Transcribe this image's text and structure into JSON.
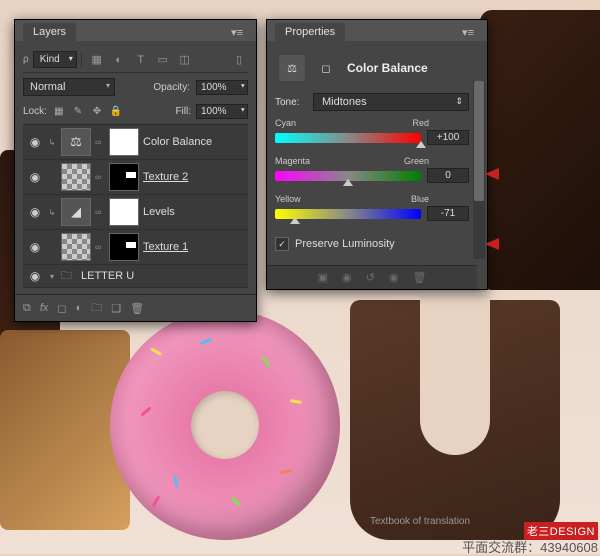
{
  "layers_panel": {
    "title": "Layers",
    "filter_kind": "Kind",
    "blend_mode": "Normal",
    "opacity_label": "Opacity:",
    "opacity_value": "100%",
    "lock_label": "Lock:",
    "fill_label": "Fill:",
    "fill_value": "100%",
    "layers": [
      {
        "name": "Color Balance",
        "type": "adjustment",
        "icon": "⚖︎"
      },
      {
        "name": "Texture 2",
        "type": "texture",
        "underlined": true
      },
      {
        "name": "Levels",
        "type": "adjustment",
        "icon": "◢"
      },
      {
        "name": "Texture 1",
        "type": "texture",
        "underlined": true
      },
      {
        "name": "LETTER U",
        "type": "group"
      }
    ]
  },
  "properties_panel": {
    "title": "Properties",
    "adjustment_title": "Color Balance",
    "tone_label": "Tone:",
    "tone_value": "Midtones",
    "sliders": [
      {
        "left_label": "Cyan",
        "right_label": "Red",
        "value": "+100",
        "pct": 100
      },
      {
        "left_label": "Magenta",
        "right_label": "Green",
        "value": "0",
        "pct": 50
      },
      {
        "left_label": "Yellow",
        "right_label": "Blue",
        "value": "-71",
        "pct": 14
      }
    ],
    "preserve_luminosity_label": "Preserve Luminosity",
    "preserve_luminosity_checked": true
  },
  "watermarks": {
    "textbook": "Textbook of translation",
    "brand": "老三DESIGN",
    "qq": "平面交流群：43940608"
  }
}
